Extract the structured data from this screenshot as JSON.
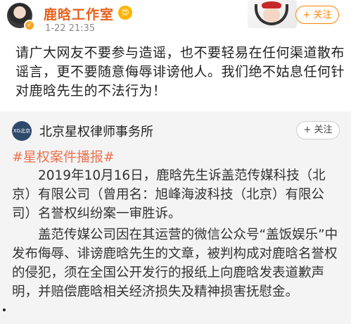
{
  "header": {
    "account_name": "鹿晗工作室",
    "vip_emoji": "😍",
    "verify_badge": "✓",
    "timestamp": "1-22 21:35",
    "follow_label": "+ 关注"
  },
  "post": {
    "text": "请广大网友不要参与造谣，也不要轻易在任何渠道散布谣言，更不要随意侮辱诽谤他人。我们绝不姑息任何针对鹿晗先生的不法行为！"
  },
  "repost": {
    "avatar_text": "XG北京",
    "account_name": "北京星权律师事务所",
    "follow_label": "+ 关注",
    "topic": "#星权案件播报#",
    "paragraph_1": "　　2019年10月16日，鹿晗先生诉盖范传媒科技（北京）有限公司（曾用名：旭峰海波科技（北京）有限公司）名誉权纠纷案一审胜诉。",
    "paragraph_2": "　　盖范传媒公司因在其运营的微信公众号“盖饭娱乐”中发布侮辱、诽谤鹿晗先生的文章，被判构成对鹿晗名誉权的侵犯，须在全国公开发行的报纸上向鹿晗发表道歉声明，并赔偿鹿晗相关经济损失及精神损害抚慰金。"
  },
  "colors": {
    "name_orange": "#e8601c",
    "follow_orange": "#ff8200",
    "topic_color": "#eb7350",
    "repost_bg": "#f4f4f4"
  }
}
